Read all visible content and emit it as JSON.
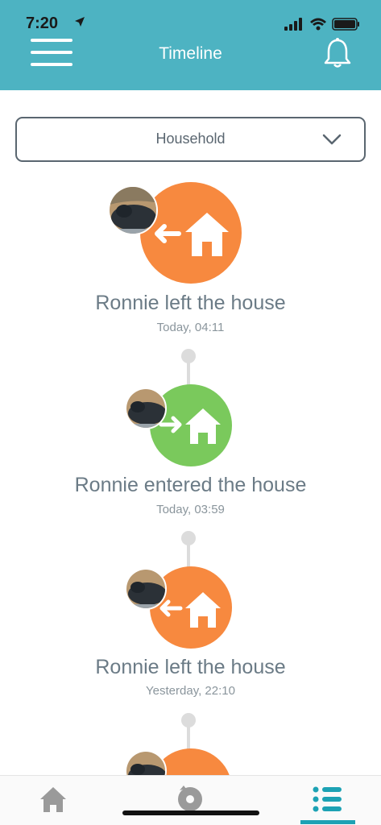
{
  "status_bar": {
    "time": "7:20"
  },
  "header": {
    "title": "Timeline"
  },
  "filter": {
    "selected": "Household"
  },
  "events": [
    {
      "title": "Ronnie left the house",
      "time": "Today, 04:11",
      "type": "left",
      "color": "#f7893f"
    },
    {
      "title": "Ronnie entered the house",
      "time": "Today, 03:59",
      "type": "entered",
      "color": "#7ac95c"
    },
    {
      "title": "Ronnie left the house",
      "time": "Yesterday, 22:10",
      "type": "left",
      "color": "#f7893f"
    },
    {
      "title": "",
      "time": "",
      "type": "left",
      "color": "#f7893f"
    }
  ],
  "tabbar": {
    "items": [
      {
        "icon": "home-icon",
        "active": false
      },
      {
        "icon": "cat-flap-icon",
        "active": false
      },
      {
        "icon": "timeline-list-icon",
        "active": true
      }
    ]
  },
  "colors": {
    "accent": "#4db3c2",
    "orange": "#f7893f",
    "green": "#7ac95c",
    "active_tab": "#1da2b4"
  }
}
